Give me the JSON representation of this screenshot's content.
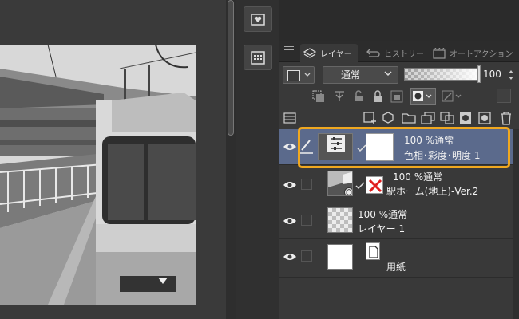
{
  "panel": {
    "tabs": [
      {
        "label": "レイヤー",
        "icon": "layers-icon",
        "active": true
      },
      {
        "label": "ヒストリー",
        "icon": "history-icon",
        "active": false
      },
      {
        "label": "オートアクション",
        "icon": "auto-action-icon",
        "active": false
      }
    ],
    "blend_mode": "通常",
    "opacity_value": "100",
    "opacity_fraction": 1.0
  },
  "layers": [
    {
      "line1": "100 %通常",
      "line2": "色相･彩度･明度 1",
      "selected": true,
      "type": "tonal-correction"
    },
    {
      "line1": "100 %通常",
      "line2": "駅ホーム(地上)-Ver.2",
      "selected": false,
      "type": "3d"
    },
    {
      "line1": "100 %通常",
      "line2": "レイヤー 1",
      "selected": false,
      "type": "raster"
    },
    {
      "line1": "",
      "line2": "用紙",
      "selected": false,
      "type": "paper"
    }
  ],
  "colors": {
    "selected_row": "#5b6a8c",
    "highlight_frame": "#f0a820",
    "panel_bg": "#393939"
  }
}
